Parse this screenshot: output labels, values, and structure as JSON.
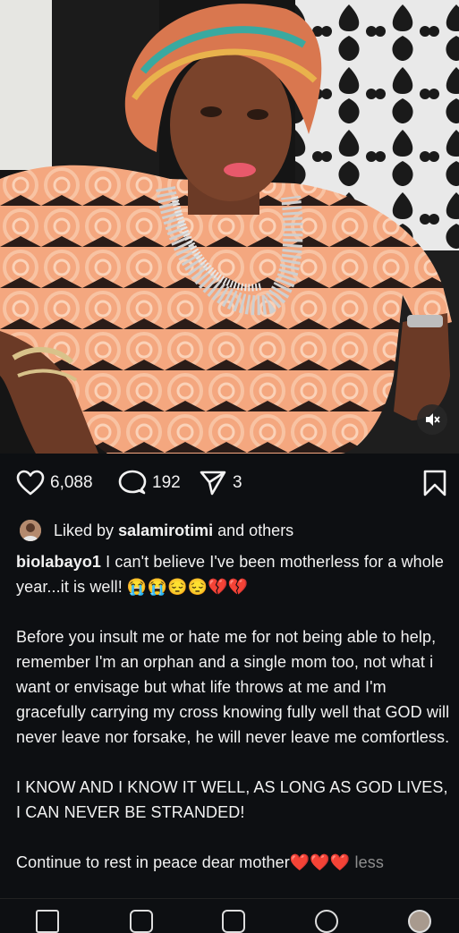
{
  "post": {
    "likes": "6,088",
    "comments": "192",
    "shares": "3",
    "liked_by_prefix": "Liked by",
    "liked_by_user": "salamirotimi",
    "liked_by_suffix": "and others",
    "username": "biolabayo1",
    "caption_line1": "I can't believe I've been motherless for a whole year...it is well! 😭😭😔😔💔💔",
    "caption_p2": "Before you insult me or hate me for not being able to help, remember I'm an orphan and a single mom too, not what i want or envisage  but what life throws at me and I'm gracefully carrying my cross knowing fully well that GOD will never leave nor forsake, he will never leave me comfortless.",
    "caption_p3": "I KNOW AND I KNOW IT WELL, AS LONG AS GOD LIVES, I CAN NEVER BE STRANDED!",
    "caption_p4": "Continue to rest in peace dear mother❤️❤️❤️",
    "less_label": "less"
  },
  "icons": {
    "like": "heart-icon",
    "comment": "comment-icon",
    "share": "send-icon",
    "save": "bookmark-icon",
    "mute": "muted-speaker-icon"
  },
  "colors": {
    "background": "#0d0f12",
    "text": "#f2f2f2",
    "muted": "#8e8e8e"
  }
}
